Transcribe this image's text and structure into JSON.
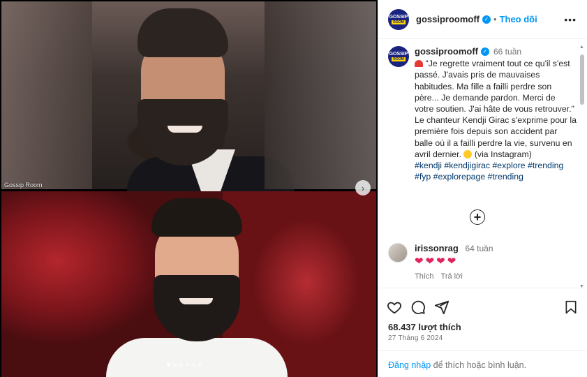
{
  "media": {
    "watermark": "Gossip Room",
    "next_button": "›",
    "carousel_dots": 6,
    "active_dot": 0
  },
  "post": {
    "avatar_top": "GOSSIP",
    "avatar_bottom": "ROOM",
    "username": "gossiproomoff",
    "separator": "•",
    "follow_label": "Theo dõi",
    "more_label": "•••"
  },
  "caption": {
    "username": "gossiproomoff",
    "time": "66 tuần",
    "line1": "\"Je regrette vraiment tout ce qu'il s'est passé. J'avais pris de mauvaises habitudes. Ma fille a failli perdre son père... Je demande pardon. Merci de votre soutien. J'ai hâte de vous retrouver.\"",
    "line2": "Le chanteur Kendji Girac s'exprime pour la première fois depuis son accident par balle où il a failli perdre la vie, survenu en avril dernier.",
    "line2_suffix": "(via Instagram)",
    "hashtags": [
      "#kendji",
      "#kendjigirac",
      "#explore",
      "#trending",
      "#fyp",
      "#explorepage",
      "#trending"
    ]
  },
  "load_more": "+",
  "comment": {
    "username": "irissonrag",
    "time": "64 tuần",
    "hearts": [
      "❤",
      "❤",
      "❤",
      "❤"
    ],
    "like_label": "Thích",
    "reply_label": "Trả lời"
  },
  "stats": {
    "likes": "68.437 lượt thích",
    "date": "27 Tháng 6 2024"
  },
  "footer": {
    "login_link": "Đăng nhập",
    "login_text": "để thích hoặc bình luận."
  },
  "icons": {
    "like": "heart-icon",
    "comment": "comment-icon",
    "share": "share-icon",
    "save": "bookmark-icon"
  },
  "colors": {
    "accent": "#0095f6",
    "heart": "#e0245e",
    "hashtag": "#00376b"
  }
}
